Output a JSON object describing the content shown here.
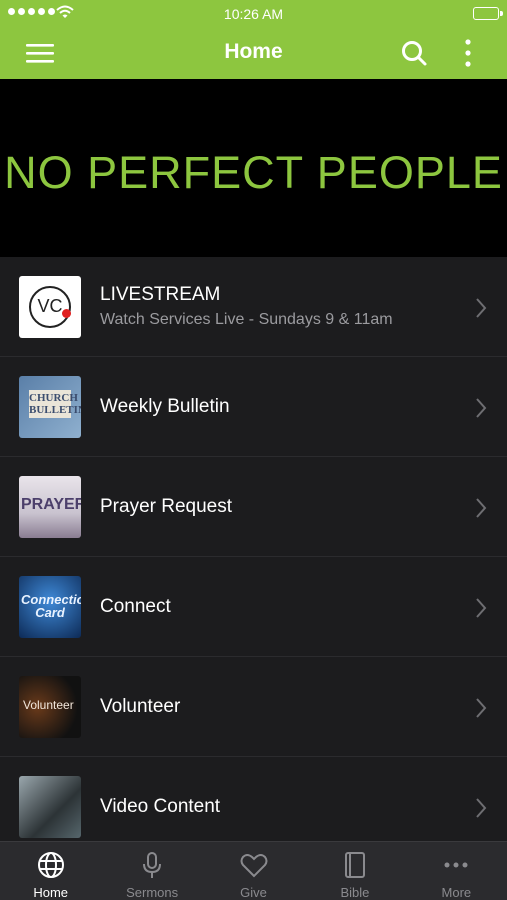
{
  "status_bar": {
    "time": "10:26 AM"
  },
  "nav": {
    "title": "Home"
  },
  "banner": {
    "text": "NO PERFECT PEOPLE"
  },
  "list": [
    {
      "title": "LIVESTREAM",
      "subtitle": "Watch Services Live - Sundays 9 & 11am",
      "thumb_text": "VC"
    },
    {
      "title": "Weekly Bulletin",
      "thumb_text": "CHURCH BULLETIN"
    },
    {
      "title": "Prayer Request",
      "thumb_text": "PRAYER"
    },
    {
      "title": "Connect",
      "thumb_text": "Connection Card"
    },
    {
      "title": "Volunteer",
      "thumb_text": "Volunteer"
    },
    {
      "title": "Video Content"
    }
  ],
  "tabs": [
    {
      "label": "Home",
      "icon": "globe-icon",
      "active": true
    },
    {
      "label": "Sermons",
      "icon": "microphone-icon"
    },
    {
      "label": "Give",
      "icon": "heart-icon"
    },
    {
      "label": "Bible",
      "icon": "book-icon"
    },
    {
      "label": "More",
      "icon": "ellipsis-icon"
    }
  ],
  "colors": {
    "accent": "#8dc63f",
    "background": "#1c1c1e",
    "tab_bar": "#2b2b2e"
  }
}
